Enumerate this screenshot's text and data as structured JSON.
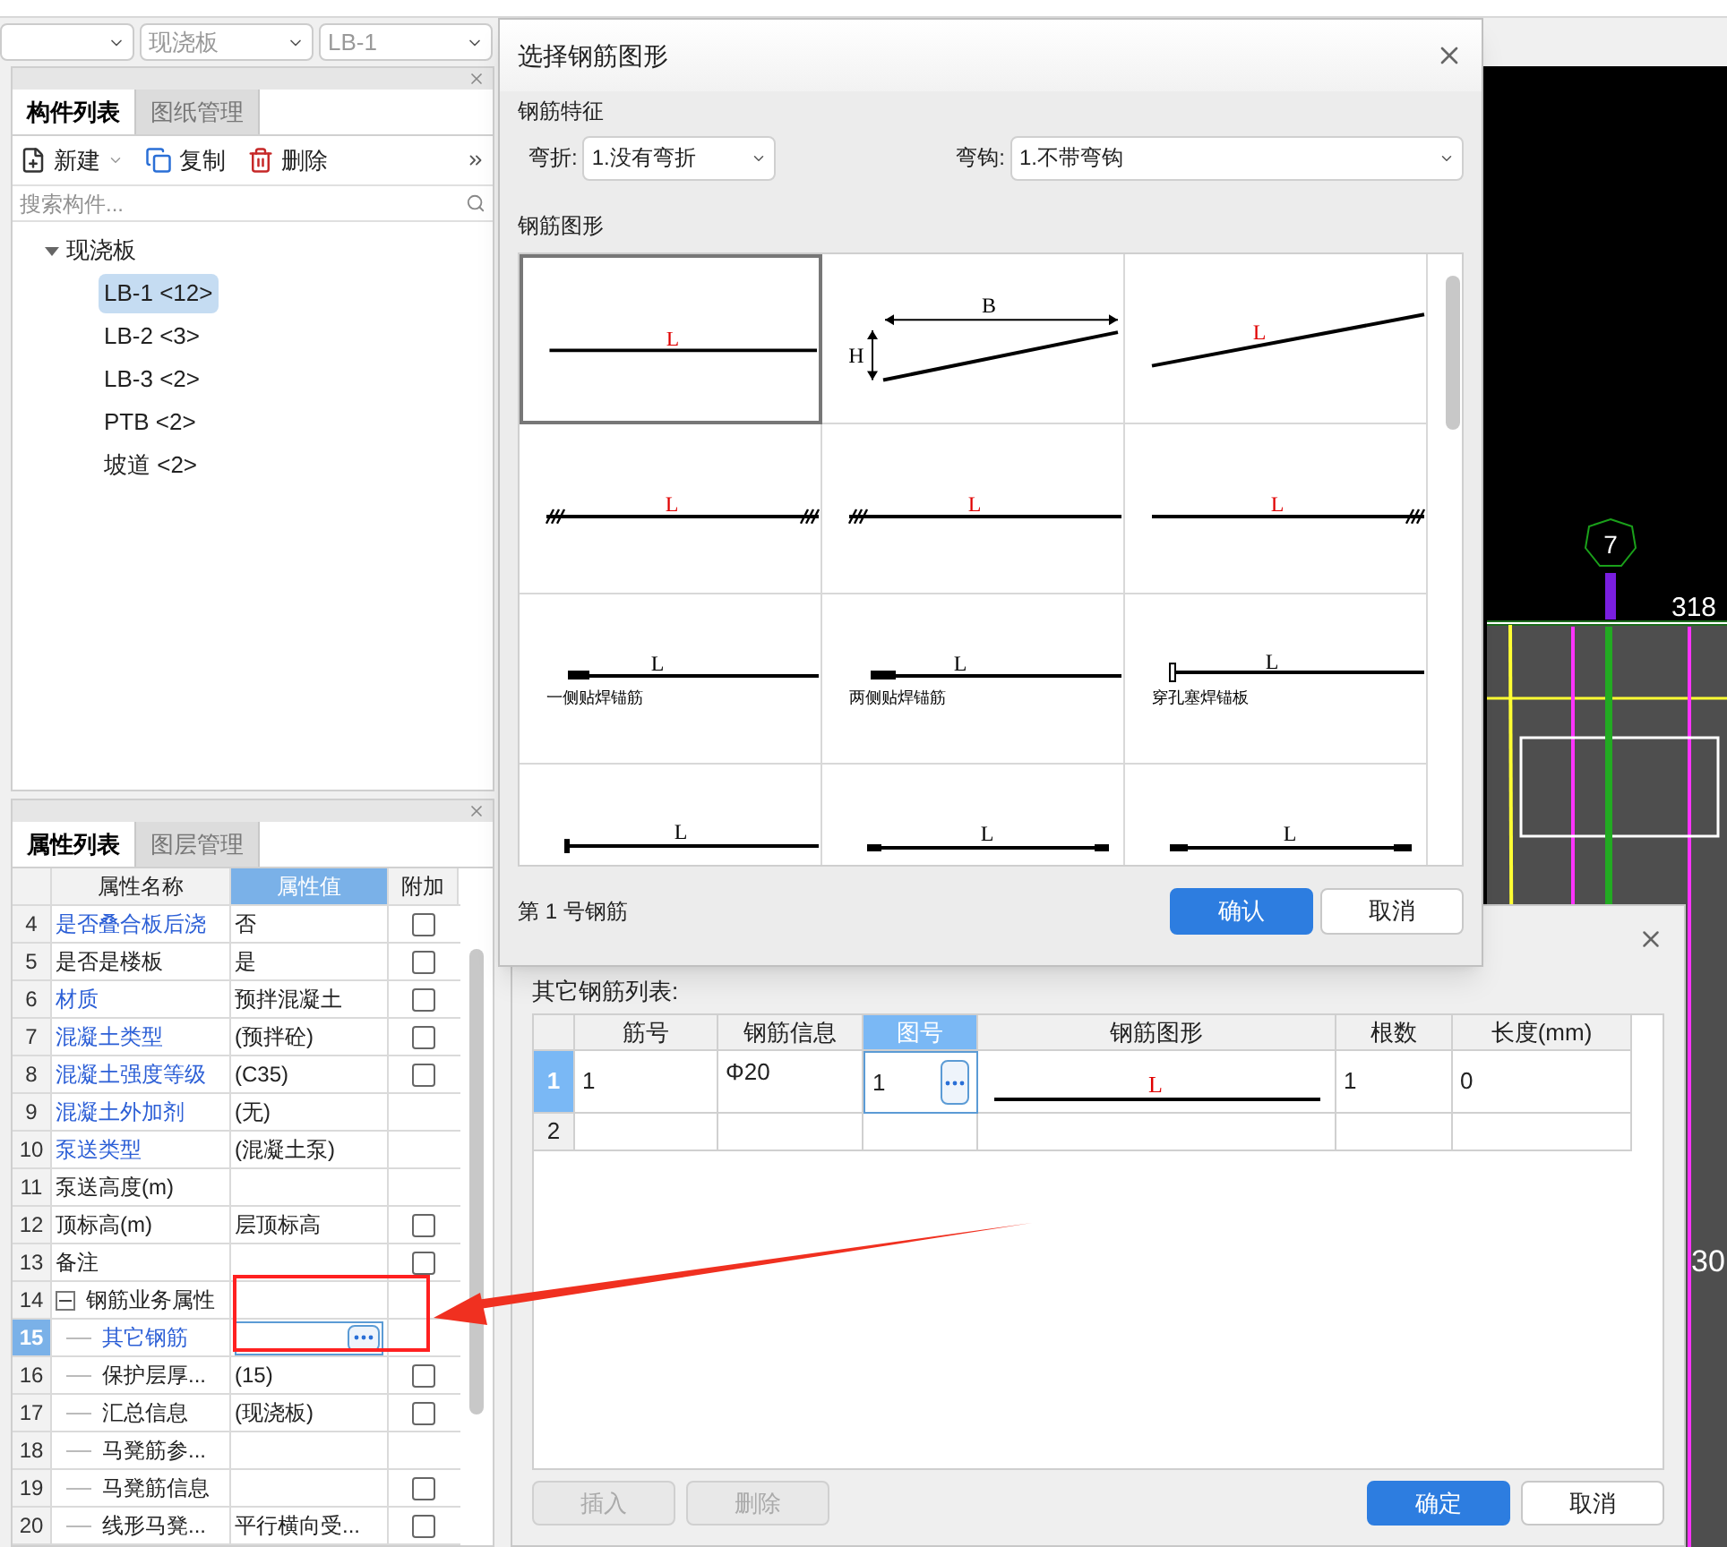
{
  "selectors": [
    {
      "value": "现浇板",
      "disabled": true
    },
    {
      "value": "LB-1",
      "disabled": true
    }
  ],
  "component_panel": {
    "tabs": [
      {
        "label": "构件列表",
        "selected": true
      },
      {
        "label": "图纸管理",
        "selected": false
      }
    ],
    "toolbar": [
      {
        "kind": "new",
        "label": "新建"
      },
      {
        "kind": "copy",
        "label": "复制"
      },
      {
        "kind": "delete",
        "label": "删除"
      }
    ],
    "search": {
      "placeholder": "搜索构件..."
    },
    "tree": [
      {
        "label": "现浇板",
        "expanded": true,
        "children": [
          {
            "label": "LB-1 <12>",
            "selected": true
          },
          {
            "label": "LB-2 <3>",
            "selected": false
          },
          {
            "label": "LB-3 <2>",
            "selected": false
          },
          {
            "label": "PTB <2>",
            "selected": false
          },
          {
            "label": "坡道 <2>",
            "selected": false
          }
        ]
      }
    ]
  },
  "property_panel": {
    "tabs": [
      {
        "label": "属性列表",
        "selected": true
      },
      {
        "label": "图层管理",
        "selected": false
      }
    ],
    "columns": [
      "属性名称",
      "属性值",
      "附加"
    ],
    "rows": [
      {
        "no": "4",
        "name": "是否叠合板后浇",
        "value": "否",
        "public": true,
        "selected": false,
        "checked": false
      },
      {
        "no": "5",
        "name": "是否是楼板",
        "value": "是",
        "public": false,
        "selected": false,
        "checked": false
      },
      {
        "no": "6",
        "name": "材质",
        "value": "预拌混凝土",
        "public": true,
        "selected": false,
        "checked": false
      },
      {
        "no": "7",
        "name": "混凝土类型",
        "value": "(预拌砼)",
        "public": true,
        "selected": false,
        "checked": false
      },
      {
        "no": "8",
        "name": "混凝土强度等级",
        "value": "(C35)",
        "public": true,
        "selected": false,
        "checked": false
      },
      {
        "no": "9",
        "name": "混凝土外加剂",
        "value": "(无)",
        "public": true,
        "selected": false
      },
      {
        "no": "10",
        "name": "泵送类型",
        "value": "(混凝土泵)",
        "public": true,
        "selected": false
      },
      {
        "no": "11",
        "name": "泵送高度(m)",
        "public": false,
        "selected": false
      },
      {
        "no": "12",
        "name": "顶标高(m)",
        "value": "层顶标高",
        "public": false,
        "selected": false,
        "checked": false
      },
      {
        "no": "13",
        "name": "备注",
        "public": false,
        "selected": false,
        "checked": false
      },
      {
        "no": "14",
        "name": "钢筋业务属性",
        "public": false,
        "selected": false,
        "expanded": true,
        "children": [
          {
            "no": "15",
            "name": "其它钢筋",
            "public": true,
            "selected": true,
            "editing": true
          },
          {
            "no": "16",
            "name": "保护层厚...",
            "value": "(15)",
            "public": false,
            "selected": false,
            "checked": false
          },
          {
            "no": "17",
            "name": "汇总信息",
            "value": "(现浇板)",
            "public": false,
            "selected": false,
            "checked": false
          },
          {
            "no": "18",
            "name": "马凳筋参...",
            "public": false,
            "selected": false
          },
          {
            "no": "19",
            "name": "马凳筋信息",
            "public": false,
            "selected": false,
            "checked": false
          },
          {
            "no": "20",
            "name": "线形马凳...",
            "value": "平行横向受...",
            "public": false,
            "selected": false,
            "checked": false
          }
        ]
      }
    ]
  },
  "shape_dialog": {
    "title": "选择钢筋图形",
    "feature_section": "钢筋特征",
    "bend": {
      "label": "弯折:",
      "value": "1.没有弯折"
    },
    "hook": {
      "label": "弯钩:",
      "value": "1.不带弯钩"
    },
    "shape_section": "钢筋图形",
    "shapes": [
      {
        "kind": "straight",
        "dims": [
          "L"
        ],
        "selected": true
      },
      {
        "kind": "bent",
        "dims": [
          "B",
          "H"
        ],
        "selected": false
      },
      {
        "kind": "sloped",
        "dims": [
          "L"
        ],
        "selected": false
      },
      {
        "kind": "hooks_both",
        "dims": [
          "L"
        ],
        "selected": false
      },
      {
        "kind": "hook_left",
        "dims": [
          "L"
        ],
        "selected": false
      },
      {
        "kind": "hook_right",
        "dims": [
          "L"
        ],
        "selected": false
      },
      {
        "kind": "weld_one",
        "dims": [
          "L"
        ],
        "caption": "一侧贴焊锚筋",
        "selected": false
      },
      {
        "kind": "weld_two",
        "dims": [
          "L"
        ],
        "caption": "两侧贴焊锚筋",
        "selected": false
      },
      {
        "kind": "plate",
        "dims": [
          "L"
        ],
        "caption": "穿孔塞焊锚板",
        "selected": false
      },
      {
        "kind": "end_left",
        "dims": [
          "L"
        ],
        "selected": false
      },
      {
        "kind": "ends_small",
        "dims": [
          "L"
        ],
        "selected": false
      },
      {
        "kind": "ends_large",
        "dims": [
          "L"
        ],
        "selected": false
      }
    ],
    "status": "第 1 号钢筋",
    "buttons": [
      {
        "label": "确认",
        "primary": true
      },
      {
        "label": "取消",
        "primary": false
      }
    ]
  },
  "rebar_dialog": {
    "list_label": "其它钢筋列表:",
    "columns": [
      "筋号",
      "钢筋信息",
      "图号",
      "钢筋图形",
      "根数",
      "长度(mm)"
    ],
    "rows": [
      {
        "no": "1",
        "selected": true,
        "bar_no": "1",
        "info": "Φ20",
        "shape_no": "1",
        "shape_label": "L",
        "count": "1",
        "length": "0"
      },
      {
        "no": "2",
        "selected": false
      }
    ],
    "buttons": [
      {
        "label": "插入",
        "disabled": true,
        "primary": false
      },
      {
        "label": "删除",
        "disabled": true,
        "primary": false
      },
      {
        "label": "确定",
        "disabled": false,
        "primary": true
      },
      {
        "label": "取消",
        "disabled": false,
        "primary": false
      }
    ]
  },
  "canvas": {
    "axis_label": "7",
    "dimension": "318",
    "edge_label": "30"
  }
}
